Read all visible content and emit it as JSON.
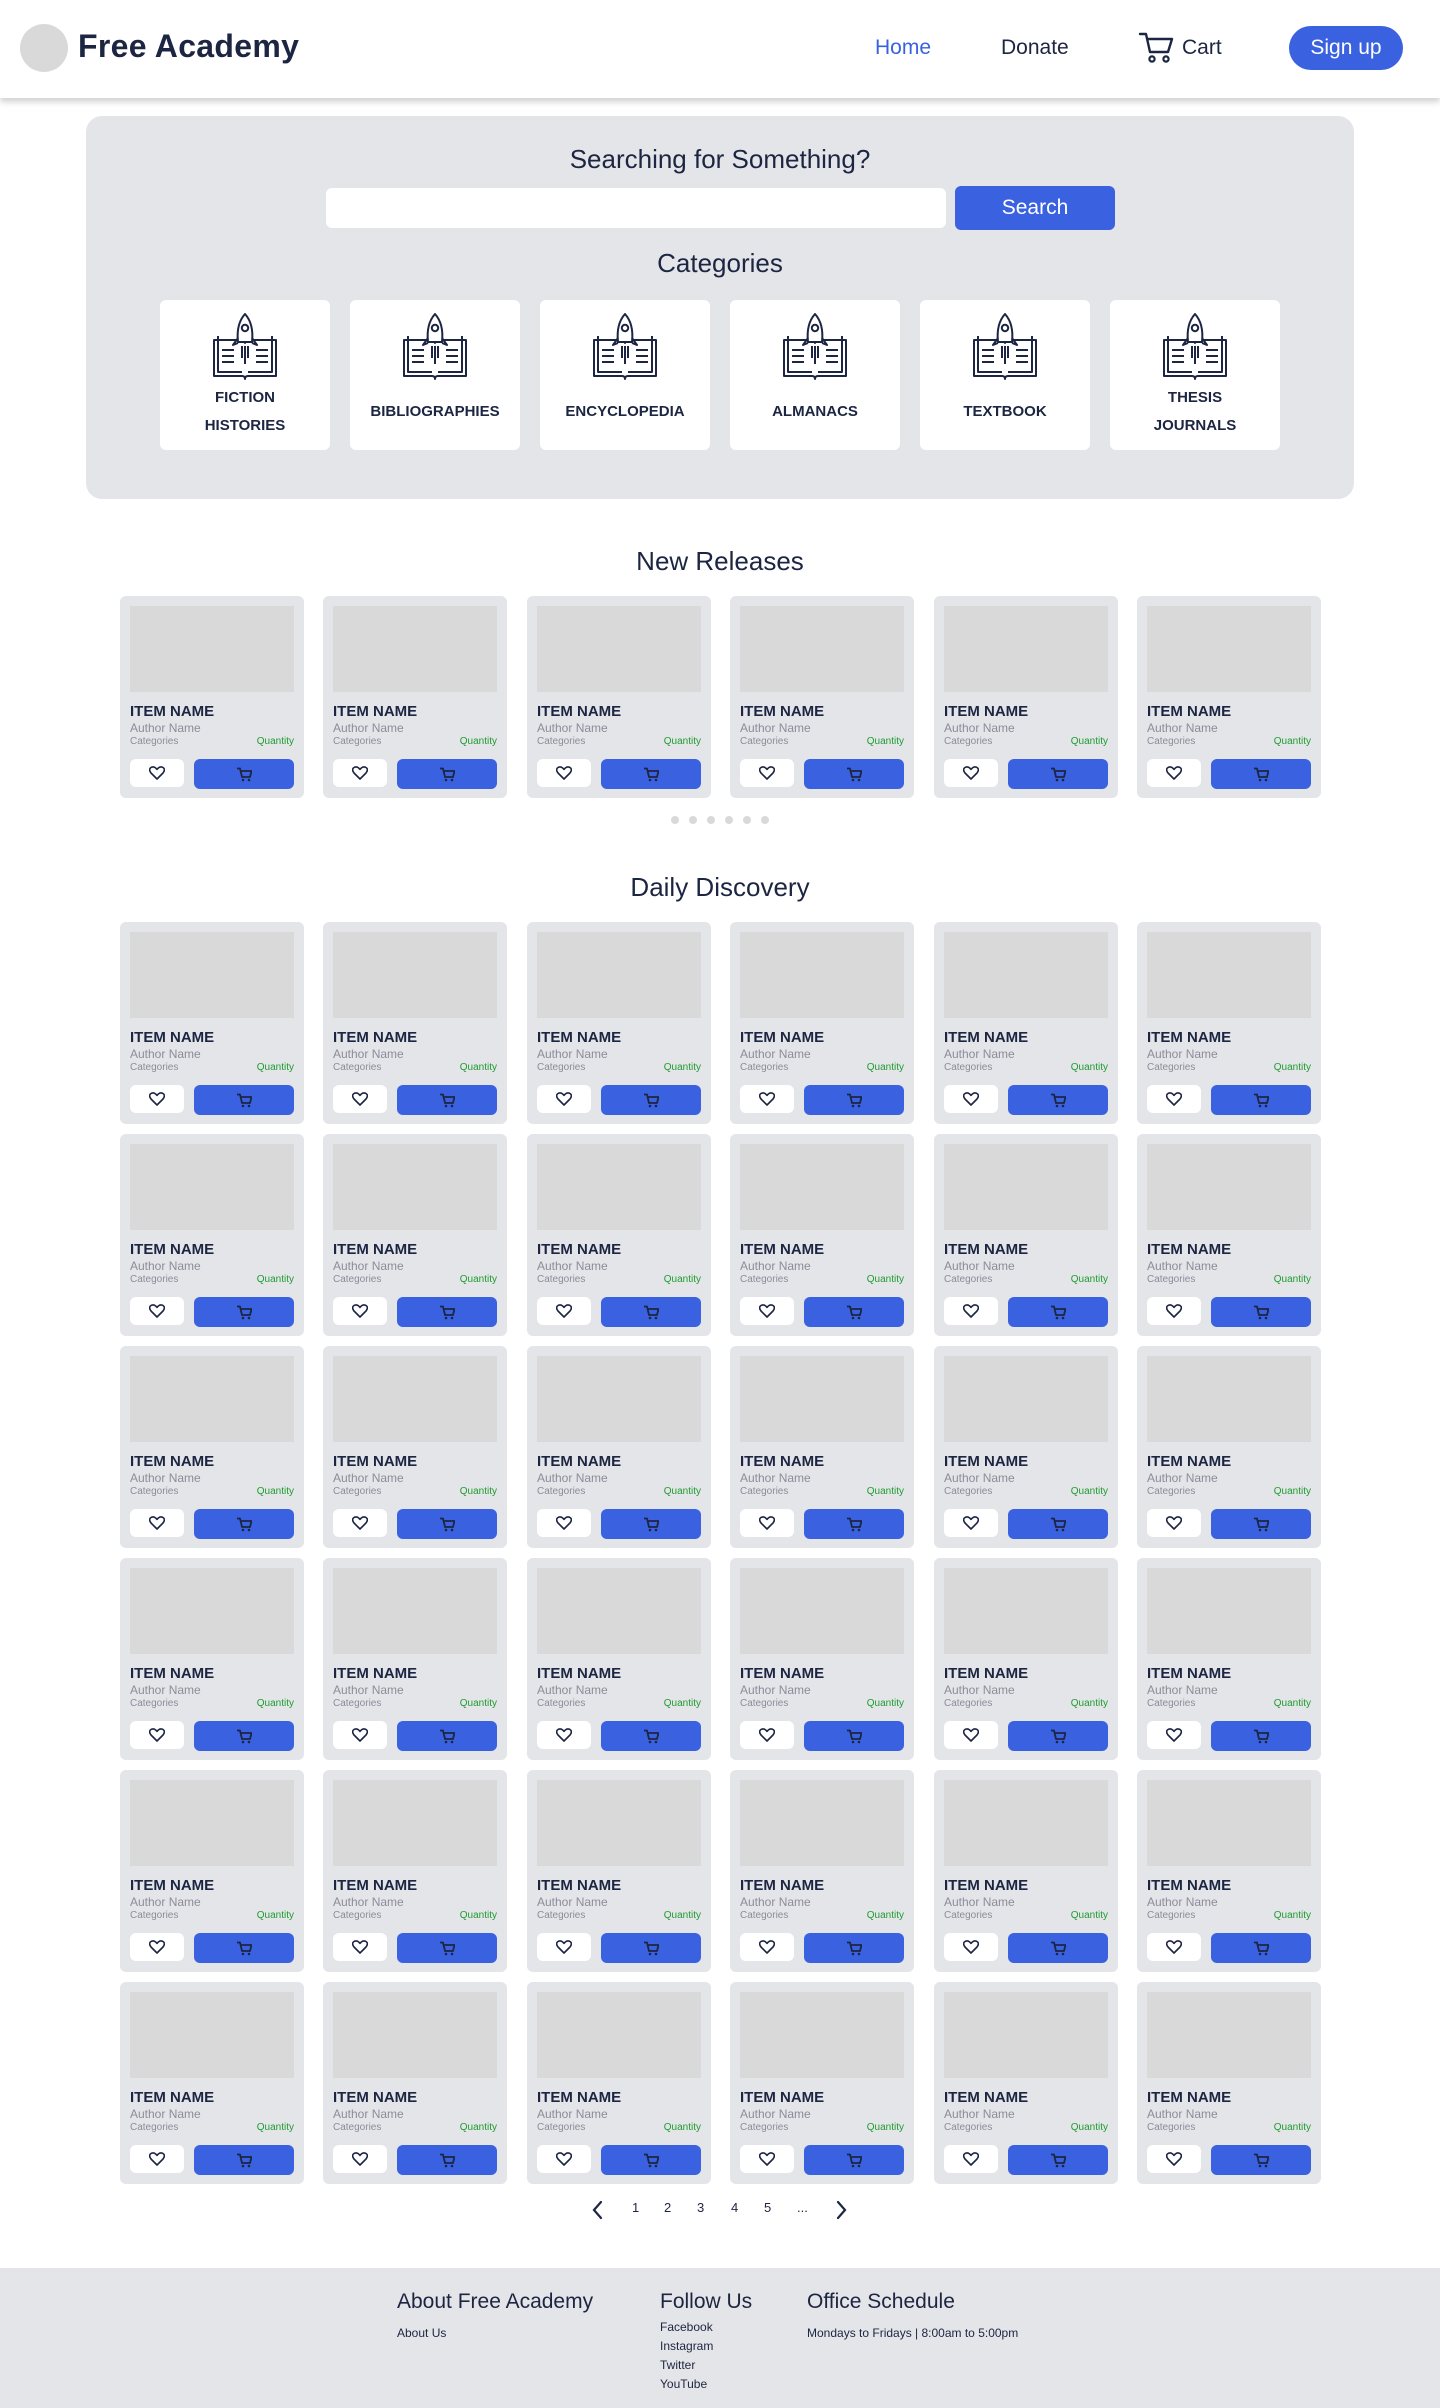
{
  "header": {
    "logo_text": "Free Academy",
    "nav": {
      "home": "Home",
      "donate": "Donate",
      "cart": "Cart"
    },
    "signup_label": "Sign up"
  },
  "search": {
    "title": "Searching for Something?",
    "placeholder": "",
    "value": "",
    "button_label": "Search"
  },
  "categories": {
    "title": "Categories",
    "items": [
      {
        "line1": "FICTION",
        "line2": "HISTORIES"
      },
      {
        "line1": "BIBLIOGRAPHIES",
        "line2": ""
      },
      {
        "line1": "ENCYCLOPEDIA",
        "line2": ""
      },
      {
        "line1": "ALMANACS",
        "line2": ""
      },
      {
        "line1": "TEXTBOOK",
        "line2": ""
      },
      {
        "line1": "THESIS",
        "line2": "JOURNALS"
      }
    ]
  },
  "new_releases": {
    "title": "New Releases",
    "carousel_pages": 6
  },
  "daily_discovery": {
    "title": "Daily Discovery",
    "rows": 6,
    "per_row": 6
  },
  "product_card": {
    "name": "ITEM NAME",
    "author": "Author Name",
    "categories": "Categories",
    "quantity": "Quantity",
    "fav_icon": "heart-icon",
    "add_icon": "cart-icon"
  },
  "pagination": {
    "pages": [
      "1",
      "2",
      "3",
      "4",
      "5",
      "..."
    ]
  },
  "footer": {
    "about": {
      "heading": "About Free Academy",
      "items": [
        "About Us"
      ]
    },
    "follow": {
      "heading": "Follow Us",
      "items": [
        "Facebook",
        "Instagram",
        "Twitter",
        "YouTube"
      ]
    },
    "schedule": {
      "heading": "Office Schedule",
      "items": [
        "Mondays to Fridays | 8:00am to 5:00pm"
      ]
    }
  },
  "colors": {
    "accent": "#3a62e0",
    "dark": "#1c2541",
    "panel": "#e4e5e9",
    "quantity": "#1e9c2e",
    "placeholder": "#d9d9d9"
  }
}
